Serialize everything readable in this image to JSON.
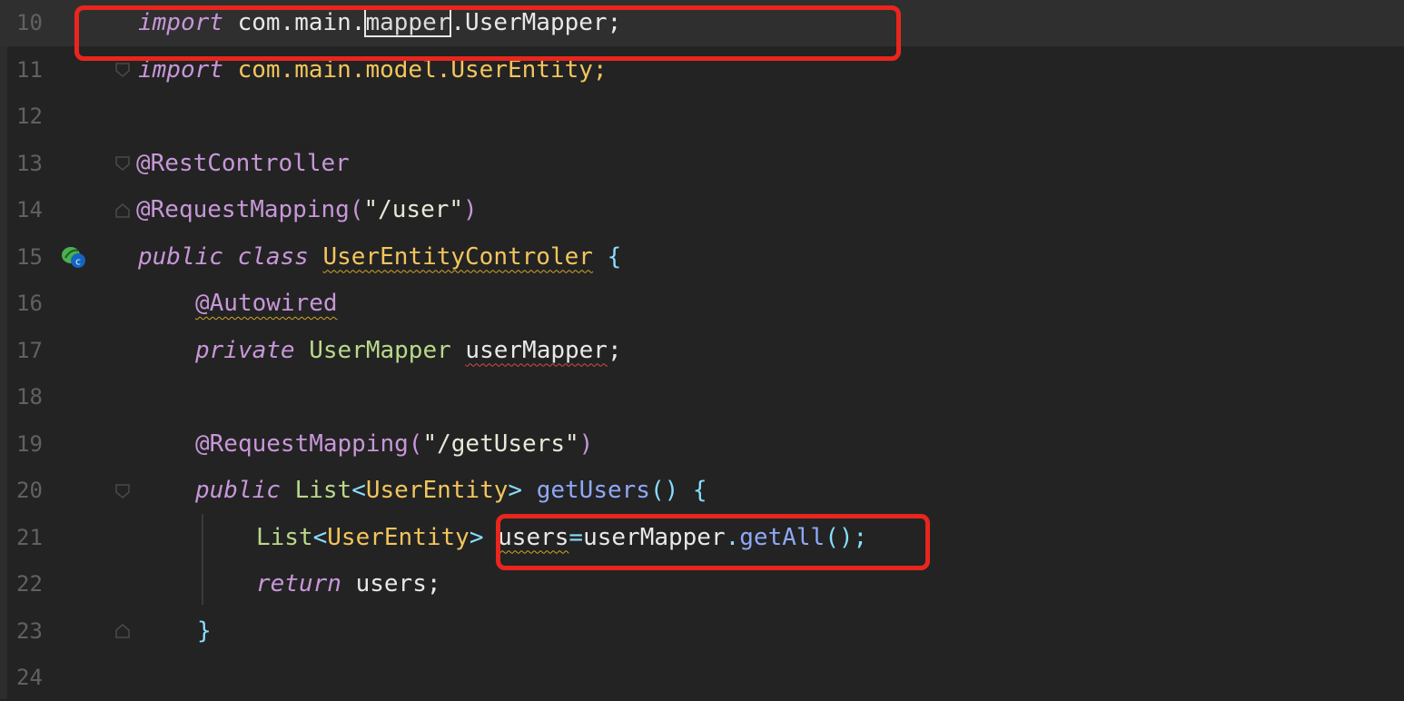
{
  "editor": {
    "lines": [
      {
        "num": "10",
        "t": [
          [
            "kw",
            "import"
          ],
          [
            "plain",
            " com.main."
          ],
          [
            "selword",
            "mapper"
          ],
          [
            "plain",
            ".UserMapper;"
          ]
        ]
      },
      {
        "num": "11",
        "t": [
          [
            "kw",
            "import"
          ],
          [
            "pkg",
            " com.main.model.UserEntity;"
          ]
        ]
      },
      {
        "num": "12",
        "t": []
      },
      {
        "num": "13",
        "t": [
          [
            "ann",
            "@RestController"
          ]
        ]
      },
      {
        "num": "14",
        "t": [
          [
            "ann",
            "@RequestMapping("
          ],
          [
            "str",
            "\"/user\""
          ],
          [
            "ann",
            ")"
          ]
        ]
      },
      {
        "num": "15",
        "t": [
          [
            "kw",
            "public class "
          ],
          [
            "cls wavy-y",
            "UserEntityControler"
          ],
          [
            "punc",
            " {"
          ]
        ]
      },
      {
        "num": "16",
        "t": [
          [
            "ann wavy-y",
            "@Autowired"
          ]
        ]
      },
      {
        "num": "17",
        "t": [
          [
            "kw",
            "private "
          ],
          [
            "typ",
            "UserMapper "
          ],
          [
            "fld wavy-r",
            "userMapper"
          ],
          [
            "plain",
            ";"
          ]
        ]
      },
      {
        "num": "18",
        "t": []
      },
      {
        "num": "19",
        "t": [
          [
            "ann",
            "@RequestMapping("
          ],
          [
            "str",
            "\"/getUsers\""
          ],
          [
            "ann",
            ")"
          ]
        ]
      },
      {
        "num": "20",
        "t": [
          [
            "kw",
            "public "
          ],
          [
            "typ",
            "List"
          ],
          [
            "punc",
            "<"
          ],
          [
            "cls",
            "UserEntity"
          ],
          [
            "punc",
            "> "
          ],
          [
            "fn",
            "getUsers"
          ],
          [
            "punc",
            "() {"
          ]
        ]
      },
      {
        "num": "21",
        "t": [
          [
            "typ",
            "List"
          ],
          [
            "punc",
            "<"
          ],
          [
            "cls",
            "UserEntity"
          ],
          [
            "punc",
            "> "
          ],
          [
            "plain wavy-y",
            "users"
          ],
          [
            "punc",
            "="
          ],
          [
            "plain",
            "userMapper"
          ],
          [
            "punc",
            "."
          ],
          [
            "fn",
            "getAll"
          ],
          [
            "punc",
            "();"
          ]
        ]
      },
      {
        "num": "22",
        "t": [
          [
            "kw",
            "return "
          ],
          [
            "plain",
            "users;"
          ]
        ]
      },
      {
        "num": "23",
        "t": [
          [
            "punc",
            "}"
          ]
        ]
      },
      {
        "num": "24",
        "t": []
      }
    ]
  },
  "colors": {
    "background": "#232323",
    "current_line": "#2f2f2f",
    "highlight_box": "#e8261e"
  },
  "icons": {
    "line15": "spring-bean-gutter-icon"
  }
}
